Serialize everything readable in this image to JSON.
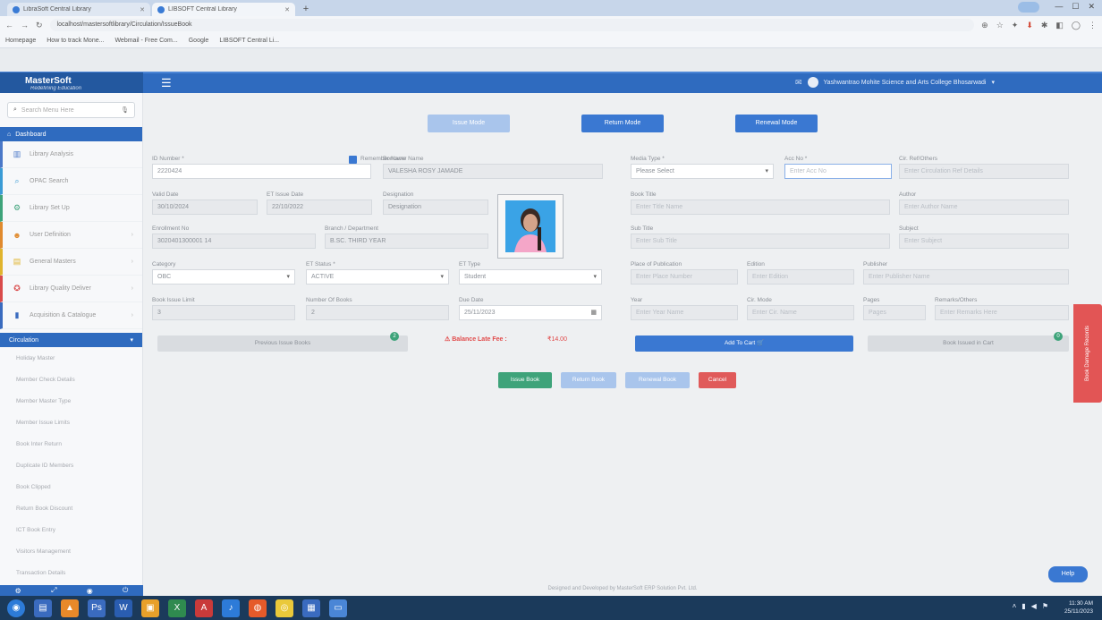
{
  "browser": {
    "tabs": [
      {
        "label": "LibraSoft Central Library",
        "active": false
      },
      {
        "label": "LIBSOFT Central Library",
        "active": true
      }
    ],
    "url": "localhost/mastersoftlibrary/Circulation/IssueBook",
    "bookmarks": [
      "Homepage",
      "How to track Mone...",
      "Webmail - Free Com...",
      "Google",
      "LIBSOFT Central Li..."
    ]
  },
  "app": {
    "logo_title": "MasterSoft",
    "logo_subtitle": "Redefining Education",
    "user_name": "Yashwantrao Mohite Science and Arts College Bhosarwadi",
    "search_placeholder": "Search Menu Here",
    "dashboard_label": "Dashboard",
    "menu_items": [
      {
        "label": "Library Analysis",
        "icon": "bar-chart-icon",
        "color": "#4a78c8"
      },
      {
        "label": "OPAC Search",
        "icon": "search-icon",
        "color": "#3a9bd5"
      },
      {
        "label": "Library Set Up",
        "icon": "gears-icon",
        "color": "#3ea37a"
      },
      {
        "label": "User Definition",
        "icon": "users-icon",
        "color": "#e08a2e"
      },
      {
        "label": "General Masters",
        "icon": "folder-icon",
        "color": "#e0b42e"
      },
      {
        "label": "Library Quality Deliver",
        "icon": "award-icon",
        "color": "#d94b4b"
      },
      {
        "label": "Acquisition & Catalogue",
        "icon": "book-icon",
        "color": "#3a6bbf"
      }
    ],
    "circulation_label": "Circulation",
    "sub_items": [
      "Holiday Master",
      "Member Check Details",
      "Member Master Type",
      "Member Issue Limits",
      "Book Inter Return",
      "Duplicate ID Members",
      "Book Clipped",
      "Return Book Discount",
      "ICT Book Entry",
      "Visitors Management",
      "Transaction Details"
    ]
  },
  "modes": {
    "issue": "Issue Mode",
    "return": "Return Mode",
    "renewal": "Renewal Mode"
  },
  "member": {
    "id_label": "ID Number *",
    "id_value": "2220424",
    "remember_label": "Remember Name",
    "borrower_label": "Borrower Name",
    "borrower_value": "VALESHA ROSY JAMADE",
    "valid_label": "Valid Date",
    "valid_value": "30/10/2024",
    "issue_date_label": "ET Issue Date",
    "issue_date_value": "22/10/2022",
    "designation_label": "Designation",
    "designation_value": "Designation",
    "enroll_label": "Enrollment No",
    "enroll_value": "3020401300001 14",
    "dept_label": "Branch / Department",
    "dept_value": "B.SC. THIRD YEAR",
    "category_label": "Category",
    "category_value": "OBC",
    "status_label": "ET Status *",
    "status_value": "ACTIVE",
    "type_label": "ET Type",
    "type_value": "Student",
    "limit_label": "Book Issue Limit",
    "limit_value": "3",
    "issued_label": "Number Of Books",
    "issued_value": "2",
    "duedate_label": "Due Date",
    "duedate_value": "25/11/2023",
    "prev_btn": "Previous Issue Books",
    "prev_count": "2",
    "fee_label": "Balance Late Fee :",
    "fee_value": "₹14.00"
  },
  "book": {
    "bookmode_label": "Media Type *",
    "bookmode_value": "Please Select",
    "accno_label": "Acc No *",
    "accno_placeholder": "Enter Acc No",
    "callno_label": "Cir. Ref/Others",
    "callno_placeholder": "Enter Circulation Ref Details",
    "title_label": "Book Title",
    "title_placeholder": "Enter Title Name",
    "author_label": "Author",
    "author_placeholder": "Enter Author Name",
    "subtitle_label": "Sub Title",
    "subtitle_placeholder": "Enter Sub Title",
    "subject_label": "Subject",
    "subject_placeholder": "Enter Subject",
    "placeofpub_label": "Place of Publication",
    "placeofpub_placeholder": "Enter Place Number",
    "edition_label": "Edition",
    "edition_placeholder": "Enter Edition",
    "publisher_label": "Publisher",
    "publisher_placeholder": "Enter Publisher Name",
    "year_label": "Year",
    "year_placeholder": "Enter Year Name",
    "cir_label": "Cir. Mode",
    "cir_placeholder": "Enter Cir. Name",
    "pages_label": "Pages",
    "pages_placeholder": "Pages",
    "rating_label": "Remarks/Others",
    "rating_placeholder": "Enter Remarks Here",
    "add_cart": "Add To Cart ",
    "cart_btn": "Book Issued in Cart",
    "cart_count": "0"
  },
  "actions": {
    "issue": "Issue Book",
    "return": "Return Book",
    "renew": "Renewal Book",
    "cancel": "Cancel"
  },
  "side_tab": "Book Damage Records",
  "footer": "Designed and Developed by MasterSoft ERP Solution Pvt. Ltd.",
  "chat": "Help",
  "clock": {
    "time": "11:30 AM",
    "date": "25/11/2023"
  }
}
